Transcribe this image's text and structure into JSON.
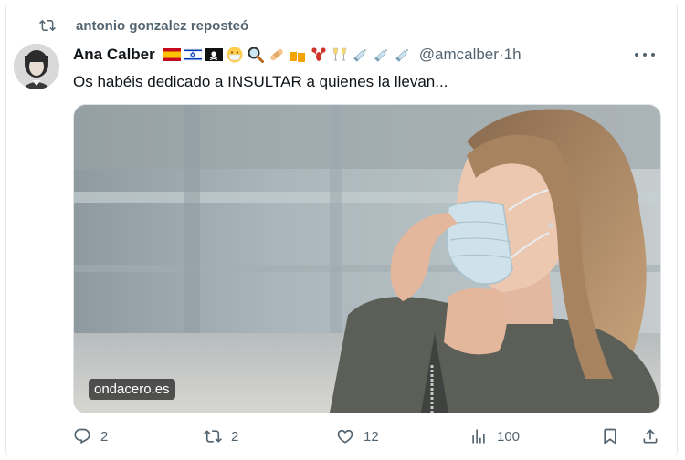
{
  "repost": {
    "text": "antonio gonzalez reposteó",
    "icon": "repost-icon"
  },
  "author": {
    "name": "Ana Calber",
    "handle": "@amcalber",
    "separator": "·",
    "time": "1h",
    "emojis": [
      "flag-spain",
      "flag-israel",
      "pirate-flag",
      "face-with-mask",
      "magnifying-glass",
      "bandage",
      "beer-mugs",
      "lobster",
      "champagne-glasses",
      "syringe",
      "syringe",
      "syringe"
    ]
  },
  "tweet": {
    "text": "Os habéis dedicado a INSULTAR a quienes la llevan...",
    "media_source": "ondacero.es"
  },
  "actions": {
    "replies": "2",
    "reposts": "2",
    "likes": "12",
    "views": "100"
  },
  "colors": {
    "secondary_text": "#536471",
    "primary_text": "#0f1419"
  }
}
